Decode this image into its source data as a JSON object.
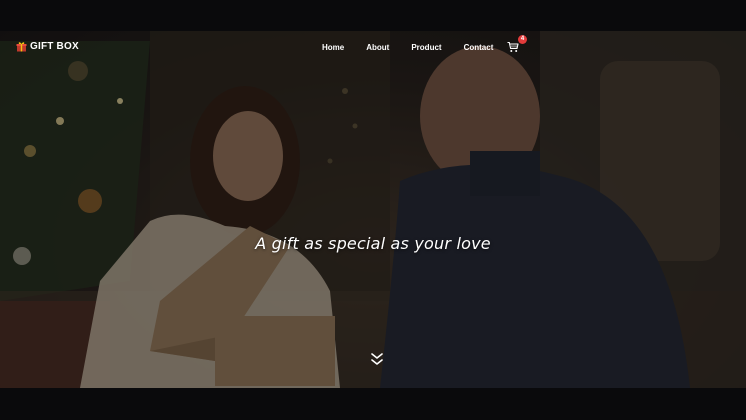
{
  "brand": {
    "name": "GIFT BOX",
    "icon": "gift-box-icon"
  },
  "nav": {
    "items": [
      {
        "label": "Home"
      },
      {
        "label": "About"
      },
      {
        "label": "Product"
      },
      {
        "label": "Contact"
      }
    ],
    "cart": {
      "icon": "cart-icon",
      "count": "4"
    }
  },
  "hero": {
    "tagline": "A gift as special as your love",
    "scroll_icon": "chevron-double-down-icon"
  },
  "colors": {
    "badge": "#e23b3b",
    "text": "#ffffff",
    "overlay": "#1c1714"
  }
}
